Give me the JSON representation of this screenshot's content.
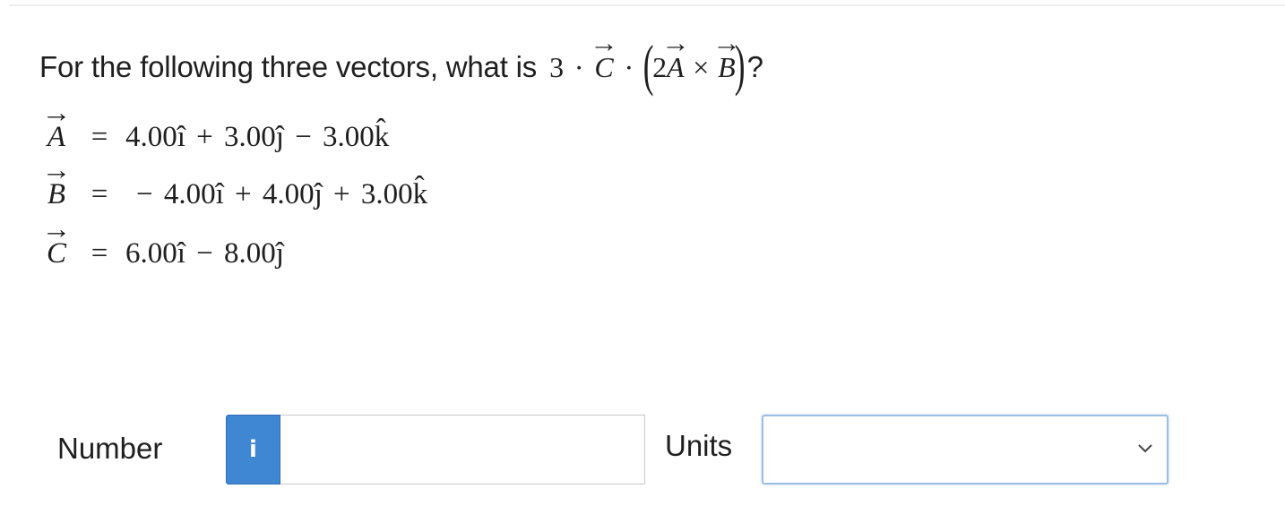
{
  "question": {
    "prefix": "For the following three vectors, what is",
    "expr": {
      "coef": "3",
      "dot": "·",
      "c": "C",
      "two": "2",
      "a": "A",
      "cross": "×",
      "b": "B"
    },
    "suffix": "?"
  },
  "vectors": [
    {
      "name": "A",
      "equals": "=",
      "expr": "4.00î + 3.00ĵ − 3.00k̂"
    },
    {
      "name": "B",
      "equals": "=",
      "expr": "− 4.00î + 4.00ĵ + 3.00k̂"
    },
    {
      "name": "C",
      "equals": "=",
      "expr": "6.00î − 8.00ĵ"
    }
  ],
  "answer": {
    "number_label": "Number",
    "info_icon_char": "i",
    "number_value": "",
    "units_label": "Units",
    "units_value": ""
  },
  "colors": {
    "info_button": "#3f87d3",
    "select_border": "#9dbde4"
  },
  "icons": {
    "info": "info-icon",
    "dropdown": "chevron-down-icon"
  }
}
